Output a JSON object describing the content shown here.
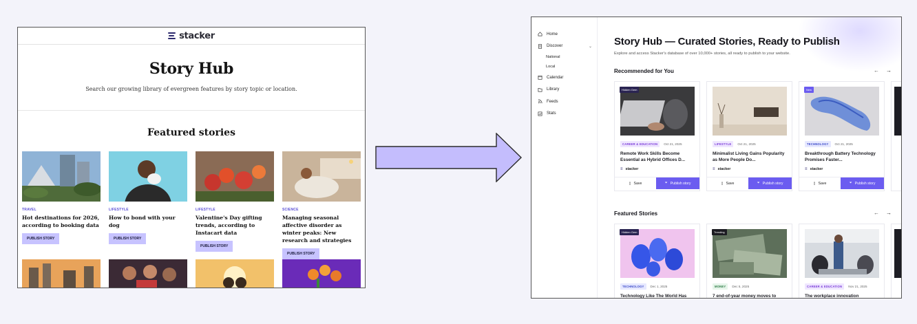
{
  "old_site": {
    "brand": "stacker",
    "title": "Story Hub",
    "subtitle": "Search our growing library of evergreen features by story topic or location.",
    "featured_heading": "Featured stories",
    "cards": [
      {
        "category": "TRAVEL",
        "headline": "Hot destinations for 2026, according to booking data",
        "button": "PUBLISH STORY"
      },
      {
        "category": "LIFESTYLE",
        "headline": "How to bond with your dog",
        "button": "PUBLISH STORY"
      },
      {
        "category": "LIFESTYLE",
        "headline": "Valentine's Day gifting trends, according to Instacart data",
        "button": "PUBLISH STORY"
      },
      {
        "category": "SCIENCE",
        "headline": "Managing seasonal affective disorder as winter peaks: New research and strategies",
        "button": "PUBLISH STORY"
      }
    ]
  },
  "new_site": {
    "nav": {
      "home": "Home",
      "discover": "Discover",
      "national": "National",
      "local": "Local",
      "calendar": "Calendar",
      "library": "Library",
      "feeds": "Feeds",
      "stats": "Stats"
    },
    "title": "Story Hub — Curated Stories, Ready to Publish",
    "subtitle": "Explore and access Stacker's database of over 10,000+ stories, all ready to publish to your website.",
    "recommended": {
      "heading": "Recommended for You",
      "cards": [
        {
          "badge": "Hidden Gem",
          "tag": "CAREER & EDUCATION",
          "date": "Oct 21, 2025",
          "title": "Remote Work Skills Become Essential as Hybrid Offices D...",
          "brand": "stacker",
          "save": "Save",
          "publish": "Publish story"
        },
        {
          "badge": "",
          "tag": "LIFESTYLE",
          "date": "Oct 21, 2025",
          "title": "Minimalist Living Gains Popularity as More People Do...",
          "brand": "stacker",
          "save": "Save",
          "publish": "Publish story"
        },
        {
          "badge": "New",
          "tag": "TECHNOLOGY",
          "date": "Oct 21, 2025",
          "title": "Breakthrough Battery Technology Promises Faster...",
          "brand": "stacker",
          "save": "Save",
          "publish": "Publish story"
        }
      ]
    },
    "featured": {
      "heading": "Featured Stories",
      "cards": [
        {
          "badge": "Hidden Gem",
          "tag": "TECHNOLOGY",
          "date": "Dec 1, 2025",
          "title": "Technology Like The World Has"
        },
        {
          "badge": "Trending",
          "tag": "MONEY",
          "date": "Dec 5, 2025",
          "title": "7 end-of-year money moves to"
        },
        {
          "badge": "",
          "tag": "CAREER & EDUCATION",
          "date": "Nov 21, 2025",
          "title": "The workplace innovation"
        }
      ]
    }
  }
}
